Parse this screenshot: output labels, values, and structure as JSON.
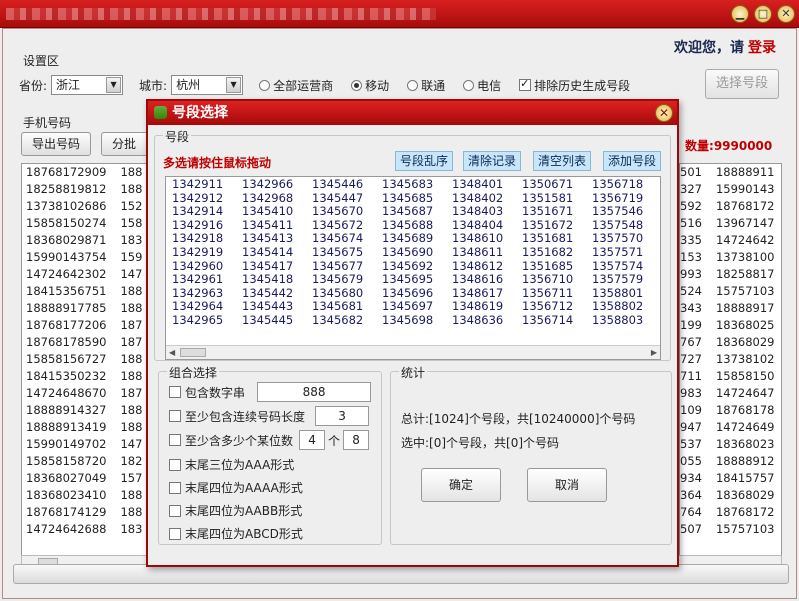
{
  "window": {
    "min_glyph": "▁",
    "max_glyph": "□",
    "close_glyph": "✕"
  },
  "header": {
    "welcome": "欢迎您，请",
    "login": "登录"
  },
  "settings": {
    "section_label": "设置区",
    "province_label": "省份:",
    "province_value": "浙江",
    "city_label": "城市:",
    "city_value": "杭州",
    "carriers": [
      {
        "label": "全部运营商",
        "selected": false
      },
      {
        "label": "移动",
        "selected": true
      },
      {
        "label": "联通",
        "selected": false
      },
      {
        "label": "电信",
        "selected": false
      }
    ],
    "exclude_history_label": "排除历史生成号段",
    "select_segment_button": "选择号段"
  },
  "phone_area": {
    "section_label": "手机号码",
    "export_button": "导出号码",
    "batch_button": "分批导",
    "quantity_label": "数量:",
    "quantity_value": "9990000",
    "left_col_a": [
      "18768172909",
      "18258819812",
      "13738102686",
      "15858150274",
      "18368029871",
      "15990143754",
      "14724642302",
      "18415356751",
      "18888917785",
      "18768177206",
      "18768178590",
      "15858156727",
      "18415350232",
      "14724648670",
      "18888914327",
      "18888913419",
      "15990149702",
      "15858158720",
      "18368027049",
      "18368023410",
      "18768174129",
      "14724642688"
    ],
    "left_col_b": [
      "188",
      "188",
      "152",
      "158",
      "183",
      "159",
      "147",
      "188",
      "188",
      "187",
      "187",
      "188",
      "188",
      "187",
      "188",
      "188",
      "147",
      "182",
      "157",
      "188",
      "188",
      "183"
    ],
    "right_col_a": [
      "501",
      "327",
      "592",
      "516",
      "335",
      "153",
      "993",
      "524",
      "343",
      "199",
      "767",
      "727",
      "711",
      "983",
      "109",
      "947",
      "537",
      "055",
      "934",
      "364",
      "764",
      "507"
    ],
    "right_col_b": [
      "18888911",
      "15990143",
      "18768172",
      "13967147",
      "14724642",
      "13738100",
      "18258817",
      "15757103",
      "18888917",
      "18368025",
      "18368029",
      "13738102",
      "15858150",
      "14724647",
      "18768178",
      "14724649",
      "18368023",
      "18888912",
      "18415757",
      "18368029",
      "18768172",
      "15757103"
    ]
  },
  "dialog": {
    "title": "号段选择",
    "close_glyph": "✕",
    "segments_group_label": "号段",
    "hint": "多选请按住鼠标拖动",
    "buttons": [
      "号段乱序",
      "清除记录",
      "清空列表",
      "添加号段"
    ],
    "segment_rows": [
      [
        "1342911",
        "1342966",
        "1345446",
        "1345683",
        "1348401",
        "1350671",
        "1356718"
      ],
      [
        "1342912",
        "1342968",
        "1345447",
        "1345685",
        "1348402",
        "1351581",
        "1356719"
      ],
      [
        "1342914",
        "1345410",
        "1345670",
        "1345687",
        "1348403",
        "1351671",
        "1357546"
      ],
      [
        "1342916",
        "1345411",
        "1345672",
        "1345688",
        "1348404",
        "1351672",
        "1357548"
      ],
      [
        "1342918",
        "1345413",
        "1345674",
        "1345689",
        "1348610",
        "1351681",
        "1357570"
      ],
      [
        "1342919",
        "1345414",
        "1345675",
        "1345690",
        "1348611",
        "1351682",
        "1357571"
      ],
      [
        "1342960",
        "1345417",
        "1345677",
        "1345692",
        "1348612",
        "1351685",
        "1357574"
      ],
      [
        "1342961",
        "1345418",
        "1345679",
        "1345695",
        "1348616",
        "1356710",
        "1357579"
      ],
      [
        "1342963",
        "1345442",
        "1345680",
        "1345696",
        "1348617",
        "1356711",
        "1358801"
      ],
      [
        "1342964",
        "1345443",
        "1345681",
        "1345697",
        "1348619",
        "1356712",
        "1358802"
      ],
      [
        "1342965",
        "1345445",
        "1345682",
        "1345698",
        "1348636",
        "1356714",
        "1358803"
      ]
    ],
    "combo_group_label": "组合选择",
    "options": {
      "contains_digits_label": "包含数字串",
      "contains_digits_value": "888",
      "consecutive_label": "至少包含连续号码长度",
      "consecutive_value": "3",
      "at_least_label": "至少含多少个某位数",
      "at_least_count": "4",
      "at_least_sep": "个",
      "at_least_digit": "8",
      "tail_aaa": "末尾三位为AAA形式",
      "tail_aaaa": "末尾四位为AAAA形式",
      "tail_aabb": "末尾四位为AABB形式",
      "tail_abcd": "末尾四位为ABCD形式"
    },
    "stats_group_label": "统计",
    "total_text": "总计:[1024]个号段，共[10240000]个号码",
    "selected_text": "选中:[0]个号段，共[0]个号码",
    "ok_button": "确定",
    "cancel_button": "取消"
  }
}
